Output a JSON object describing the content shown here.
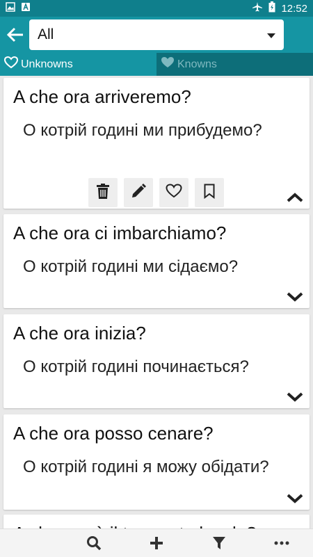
{
  "status_bar": {
    "time": "12:52",
    "battery_icon": "battery-icon",
    "airplane_icon": "airplane-icon"
  },
  "toolbar": {
    "filter_selected": "All"
  },
  "tabs": [
    {
      "label": "Unknowns",
      "icon": "heart-outline-icon",
      "active": true
    },
    {
      "label": "Knowns",
      "icon": "heart-filled-icon",
      "active": false
    }
  ],
  "cards": [
    {
      "question": "A che ora arriveremo?",
      "answer": "О котрій годині ми прибудемо?",
      "expanded": true
    },
    {
      "question": "A che ora ci imbarchiamo?",
      "answer": "О котрій годині ми сідаємо?",
      "expanded": false
    },
    {
      "question": "A che ora inizia?",
      "answer": "О котрій годині починається?",
      "expanded": false
    },
    {
      "question": "A che ora posso cenare?",
      "answer": "О котрій годині я можу обідати?",
      "expanded": false
    },
    {
      "question": "A che ora è il trasporto locale?",
      "answer": "",
      "expanded": false
    }
  ],
  "colors": {
    "primary": "#1595a3",
    "primary_dark": "#0f7f8c",
    "tab_inactive": "#0d6e79"
  }
}
